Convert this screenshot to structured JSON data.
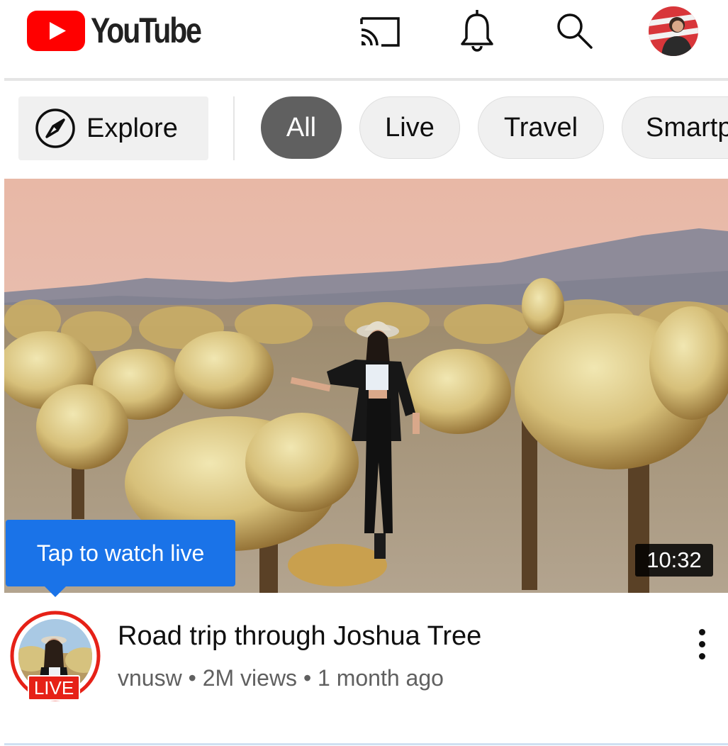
{
  "header": {
    "logo_text": "YouTube",
    "icons": [
      "cast-icon",
      "bell-icon",
      "search-icon",
      "account-avatar"
    ]
  },
  "chips": {
    "explore_label": "Explore",
    "items": [
      {
        "label": "All",
        "active": true
      },
      {
        "label": "Live",
        "active": false
      },
      {
        "label": "Travel",
        "active": false
      },
      {
        "label": "Smartp",
        "active": false
      }
    ]
  },
  "video": {
    "tooltip": "Tap to watch live",
    "duration": "10:32",
    "live_badge": "LIVE",
    "title": "Road trip through Joshua Tree",
    "meta": "vnusw • 2M views • 1 month ago"
  },
  "colors": {
    "brand_red": "#ff0000",
    "chip_active": "#606060",
    "tooltip_blue": "#1a73e8",
    "live_red": "#e62117"
  }
}
